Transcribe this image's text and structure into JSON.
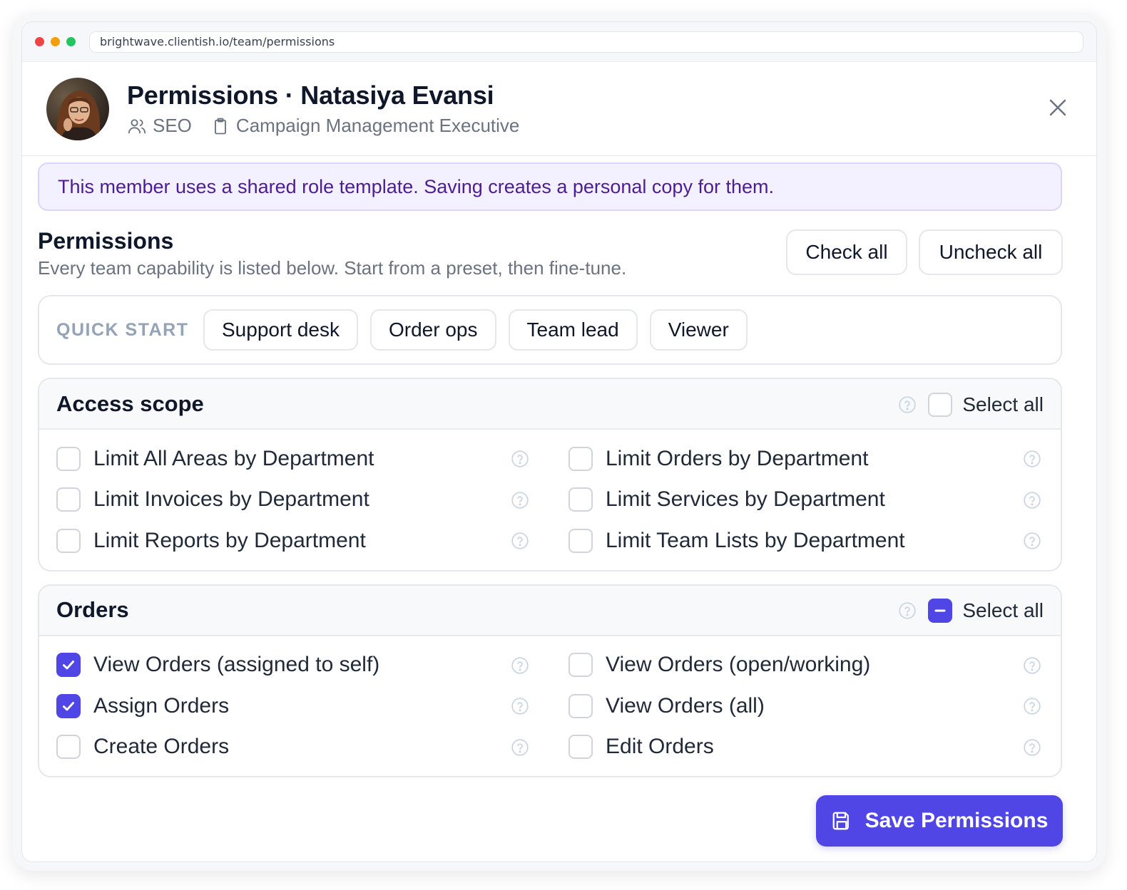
{
  "browser": {
    "url": "brightwave.clientish.io/team/permissions",
    "dots": [
      "#ef4444",
      "#f59e0b",
      "#22c55e"
    ]
  },
  "header": {
    "title": "Permissions · Natasiya Evansi",
    "team": "SEO",
    "role": "Campaign Management Executive"
  },
  "banner": {
    "text": "This member uses a shared role template. Saving creates a personal copy for them."
  },
  "permissions": {
    "title": "Permissions",
    "subtitle": "Every team capability is listed below. Start from a preset, then fine-tune.",
    "check_all": "Check all",
    "uncheck_all": "Uncheck all"
  },
  "quick_start": {
    "label": "QUICK START",
    "presets": [
      "Support desk",
      "Order ops",
      "Team lead",
      "Viewer"
    ]
  },
  "sections": [
    {
      "title": "Access scope",
      "select_all_label": "Select all",
      "select_all_state": "unchecked",
      "items": [
        {
          "label": "Limit All Areas by Department",
          "checked": false
        },
        {
          "label": "Limit Orders by Department",
          "checked": false
        },
        {
          "label": "Limit Invoices by Department",
          "checked": false
        },
        {
          "label": "Limit Services by Department",
          "checked": false
        },
        {
          "label": "Limit Reports by Department",
          "checked": false
        },
        {
          "label": "Limit Team Lists by Department",
          "checked": false
        }
      ]
    },
    {
      "title": "Orders",
      "select_all_label": "Select all",
      "select_all_state": "indeterminate",
      "items": [
        {
          "label": "View Orders (assigned to self)",
          "checked": true
        },
        {
          "label": "View Orders (open/working)",
          "checked": false
        },
        {
          "label": "Assign Orders",
          "checked": true
        },
        {
          "label": "View Orders (all)",
          "checked": false
        },
        {
          "label": "Create Orders",
          "checked": false
        },
        {
          "label": "Edit Orders",
          "checked": false
        }
      ]
    }
  ],
  "save_label": "Save Permissions",
  "colors": {
    "accent": "#4f46e5",
    "banner_bg": "#f3f0ff",
    "banner_text": "#4c1d95"
  }
}
